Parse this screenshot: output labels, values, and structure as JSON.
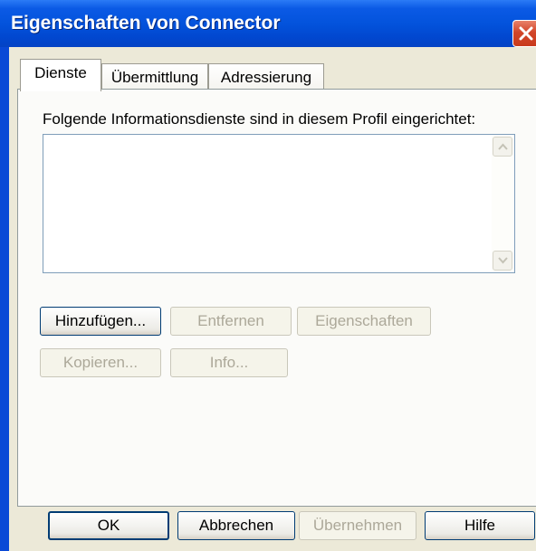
{
  "window": {
    "title": "Eigenschaften von Connector"
  },
  "tabs": [
    {
      "label": "Dienste",
      "active": true
    },
    {
      "label": "Übermittlung",
      "active": false
    },
    {
      "label": "Adressierung",
      "active": false
    }
  ],
  "services": {
    "label": "Folgende Informationsdienste sind in diesem Profil eingerichtet:",
    "items": []
  },
  "actions": {
    "add": {
      "label": "Hinzufügen...",
      "enabled": true
    },
    "remove": {
      "label": "Entfernen",
      "enabled": false
    },
    "properties": {
      "label": "Eigenschaften",
      "enabled": false
    },
    "copy": {
      "label": "Kopieren...",
      "enabled": false
    },
    "info": {
      "label": "Info...",
      "enabled": false
    }
  },
  "footer": {
    "ok": {
      "label": "OK",
      "enabled": true
    },
    "cancel": {
      "label": "Abbrechen",
      "enabled": true
    },
    "apply": {
      "label": "Übernehmen",
      "enabled": false
    },
    "help": {
      "label": "Hilfe",
      "enabled": true
    }
  },
  "colors": {
    "titlebar": "#0353dc",
    "dialog_bg": "#ece9d8",
    "disabled_text": "#aca899",
    "close_button": "#d2462a"
  },
  "icons": {
    "close": "close-icon",
    "scroll_up": "chevron-up-icon",
    "scroll_down": "chevron-down-icon"
  }
}
